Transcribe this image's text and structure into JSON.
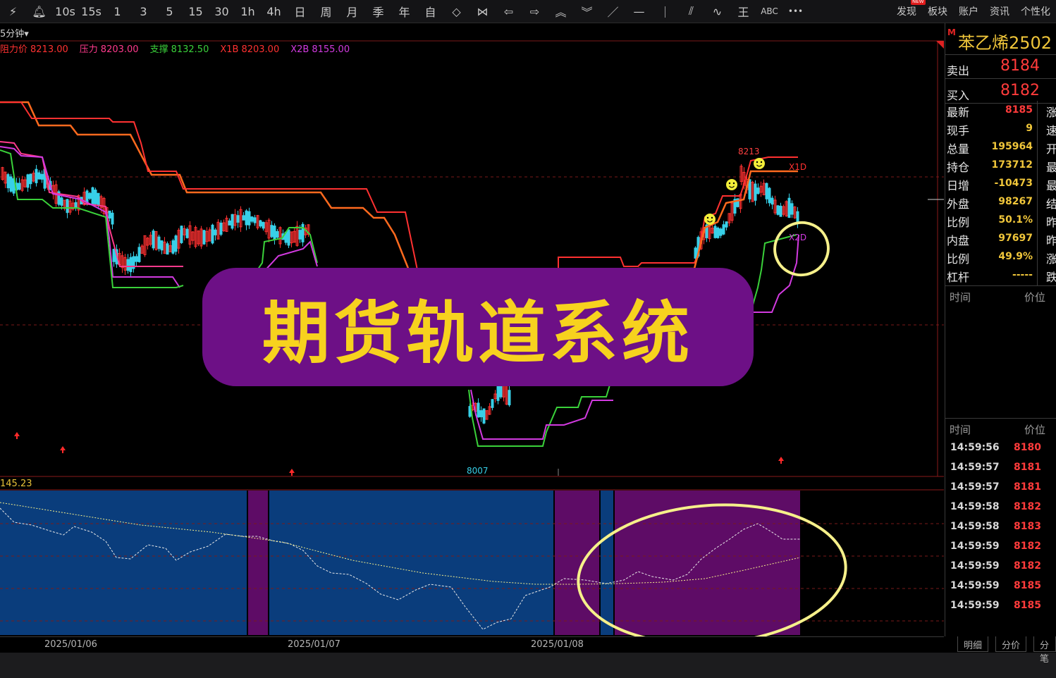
{
  "toolbar": {
    "items": [
      {
        "label": "⚡︎",
        "icon": "lightning-icon"
      },
      {
        "label": "🔔︎",
        "icon": "bell-icon"
      },
      {
        "label": "10s"
      },
      {
        "label": "15s"
      },
      {
        "label": "1"
      },
      {
        "label": "3"
      },
      {
        "label": "5"
      },
      {
        "label": "15"
      },
      {
        "label": "30"
      },
      {
        "label": "1h"
      },
      {
        "label": "4h"
      },
      {
        "label": "日"
      },
      {
        "label": "周"
      },
      {
        "label": "月"
      },
      {
        "label": "季"
      },
      {
        "label": "年"
      },
      {
        "label": "自"
      },
      {
        "label": "◇",
        "icon": "shrink-horizontal-icon"
      },
      {
        "label": "⋈",
        "icon": "expand-horizontal-icon"
      },
      {
        "label": "⇦",
        "icon": "arrow-left-icon"
      },
      {
        "label": "⇨",
        "icon": "arrow-right-icon"
      },
      {
        "label": "︽",
        "icon": "arrow-up-double-icon"
      },
      {
        "label": "︾",
        "icon": "arrow-down-double-icon"
      },
      {
        "label": "／",
        "icon": "trend-line-icon"
      },
      {
        "label": "—",
        "icon": "horizontal-line-icon"
      },
      {
        "label": "｜",
        "icon": "vertical-line-icon"
      },
      {
        "label": "⫽",
        "icon": "parallel-line-icon"
      },
      {
        "label": "∿",
        "icon": "wave-icon"
      },
      {
        "label": "王",
        "icon": "fibonacci-icon"
      },
      {
        "label": "ABC",
        "icon": "text-tool-icon"
      },
      {
        "label": "•••",
        "icon": "more-icon"
      }
    ],
    "right": [
      {
        "label": "发现",
        "badge": "NEW"
      },
      {
        "label": "板块"
      },
      {
        "label": "账户"
      },
      {
        "label": "资讯"
      },
      {
        "label": "个性化"
      }
    ]
  },
  "chart": {
    "period": "5分钟",
    "legend": [
      {
        "label": "阻力价",
        "value": "8213.00",
        "color": "#ff3131"
      },
      {
        "label": "压力",
        "value": "8203.00",
        "color": "#ff3a8c"
      },
      {
        "label": "支撑",
        "value": "8132.50",
        "color": "#3ad13a"
      },
      {
        "label": "X1B",
        "value": "8203.00",
        "color": "#ff3131"
      },
      {
        "label": "X2B",
        "value": "8155.00",
        "color": "#d23ae0"
      }
    ],
    "labels": {
      "high": "8213",
      "low": "8007",
      "x1d": "X1D",
      "x2d": "X2D"
    },
    "indicator_value": "145.23",
    "dates": [
      "2025/01/06",
      "2025/01/07",
      "2025/01/08"
    ],
    "overlay_title": "期货轨道系统",
    "colors": {
      "up": "#ff3131",
      "down": "#37d0e8",
      "support": "#3ad13a",
      "x2": "#d23ae0",
      "indicator_blue": "#0a3d7c",
      "indicator_purple": "#5e0c66",
      "highlight": "#f6f08a"
    }
  },
  "panel": {
    "symbol_marker": "M",
    "symbol": "苯乙烯2502",
    "ask_label": "卖出",
    "ask": "8184",
    "bid_label": "买入",
    "bid": "8182",
    "quotes": [
      {
        "label": "最新",
        "value": "8185",
        "color": "#ff3b3b",
        "label2": "涨"
      },
      {
        "label": "现手",
        "value": "9",
        "color": "#f0c63a",
        "label2": "速"
      },
      {
        "label": "总量",
        "value": "195964",
        "color": "#f0c63a",
        "label2": "开"
      },
      {
        "label": "持仓",
        "value": "173712",
        "color": "#f0c63a",
        "label2": "最"
      },
      {
        "label": "日增",
        "value": "-10473",
        "color": "#f0c63a",
        "label2": "最"
      },
      {
        "label": "外盘",
        "value": "98267",
        "color": "#f0c63a",
        "label2": "结"
      },
      {
        "label": "比例",
        "value": "50.1%",
        "color": "#f0c63a",
        "label2": "昨"
      },
      {
        "label": "内盘",
        "value": "97697",
        "color": "#f0c63a",
        "label2": "昨"
      },
      {
        "label": "比例",
        "value": "49.9%",
        "color": "#f0c63a",
        "label2": "涨"
      },
      {
        "label": "杠杆",
        "value": "-----",
        "color": "#f0c63a",
        "label2": "跌"
      }
    ],
    "header_time": "时间",
    "header_price": "价位",
    "ticks": [
      {
        "time": "14:59:56",
        "price": "8180"
      },
      {
        "time": "14:59:57",
        "price": "8181"
      },
      {
        "time": "14:59:57",
        "price": "8181"
      },
      {
        "time": "14:59:58",
        "price": "8182"
      },
      {
        "time": "14:59:58",
        "price": "8183"
      },
      {
        "time": "14:59:59",
        "price": "8182"
      },
      {
        "time": "14:59:59",
        "price": "8182"
      },
      {
        "time": "14:59:59",
        "price": "8185"
      },
      {
        "time": "14:59:59",
        "price": "8185"
      }
    ],
    "tabs": [
      "明细",
      "分价",
      "分笔"
    ]
  }
}
